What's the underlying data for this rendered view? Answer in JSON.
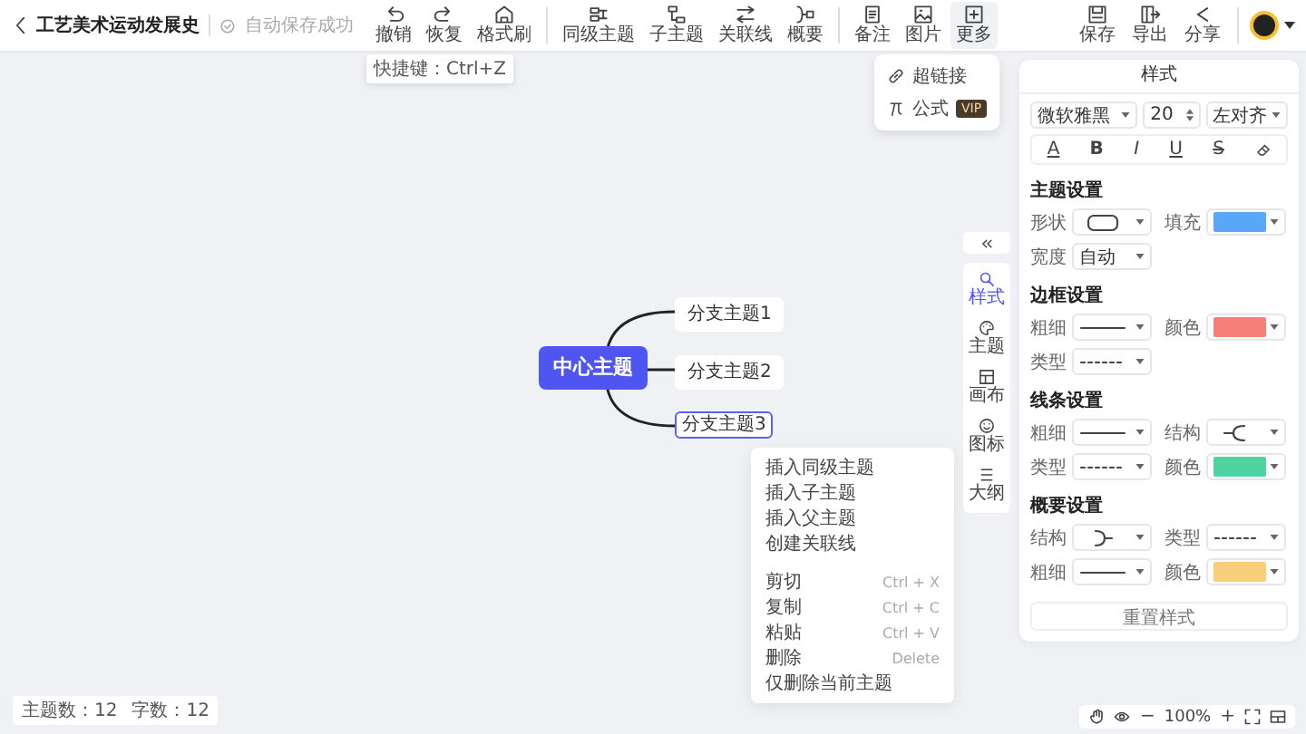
{
  "document": {
    "title": "工艺美术运动发展史",
    "save_status": "自动保存成功"
  },
  "toolbar_groups": [
    {
      "items": [
        {
          "label": "撤销",
          "tooltip": "快捷键：Ctrl+Z"
        },
        {
          "label": "恢复"
        },
        {
          "label": "格式刷"
        }
      ]
    },
    {
      "items": [
        {
          "label": "同级主题"
        },
        {
          "label": "子主题"
        },
        {
          "label": "关联线"
        },
        {
          "label": "概要"
        }
      ]
    },
    {
      "items": [
        {
          "label": "备注"
        },
        {
          "label": "图片"
        },
        {
          "label": "更多",
          "expanded": true
        }
      ]
    }
  ],
  "more_menu": [
    {
      "label": "超链接"
    },
    {
      "label": "公式",
      "badge": "VIP"
    }
  ],
  "right_actions": [
    {
      "label": "保存"
    },
    {
      "label": "导出"
    },
    {
      "label": "分享"
    }
  ],
  "mindmap": {
    "center": "中心主题",
    "branches": [
      {
        "label": "分支主题1",
        "selected": false
      },
      {
        "label": "分支主题2",
        "selected": false
      },
      {
        "label": "分支主题3",
        "selected": true
      }
    ]
  },
  "context_menu": [
    {
      "items": [
        {
          "label": "插入同级主题"
        },
        {
          "label": "插入子主题"
        },
        {
          "label": "插入父主题"
        },
        {
          "label": "创建关联线"
        }
      ]
    },
    {
      "items": [
        {
          "label": "剪切",
          "shortcut": "Ctrl + X"
        },
        {
          "label": "复制",
          "shortcut": "Ctrl + C"
        },
        {
          "label": "粘贴",
          "shortcut": "Ctrl + V"
        },
        {
          "label": "删除",
          "shortcut": "Delete"
        },
        {
          "label": "仅删除当前主题"
        }
      ]
    }
  ],
  "side_tabs": [
    {
      "label": "样式",
      "selected": true
    },
    {
      "label": "主题",
      "selected": false
    },
    {
      "label": "画布",
      "selected": false
    },
    {
      "label": "图标",
      "selected": false
    },
    {
      "label": "大纲",
      "selected": false
    }
  ],
  "style_panel": {
    "title": "样式",
    "font": "微软雅黑",
    "size": "20",
    "align": "左对齐",
    "format": [
      "A",
      "B",
      "I",
      "U",
      "S"
    ],
    "sections": [
      {
        "title": "主题设置",
        "fields": [
          {
            "label": "形状",
            "kind": "shape"
          },
          {
            "label": "填充",
            "kind": "color",
            "color": "#5aa6f8"
          },
          {
            "label": "宽度",
            "kind": "select",
            "value": "自动"
          }
        ]
      },
      {
        "title": "边框设置",
        "fields": [
          {
            "label": "粗细",
            "kind": "line"
          },
          {
            "label": "颜色",
            "kind": "color",
            "color": "#f77f7a"
          },
          {
            "label": "类型",
            "kind": "dash"
          }
        ]
      },
      {
        "title": "线条设置",
        "fields": [
          {
            "label": "粗细",
            "kind": "line"
          },
          {
            "label": "结构",
            "kind": "struct"
          },
          {
            "label": "类型",
            "kind": "dash"
          },
          {
            "label": "颜色",
            "kind": "color",
            "color": "#4fd3a0"
          }
        ]
      },
      {
        "title": "概要设置",
        "fields": [
          {
            "label": "结构",
            "kind": "brace"
          },
          {
            "label": "类型",
            "kind": "dash"
          },
          {
            "label": "粗细",
            "kind": "line"
          },
          {
            "label": "颜色",
            "kind": "color",
            "color": "#f9cf7c"
          }
        ]
      }
    ],
    "reset": "重置样式"
  },
  "status": {
    "topics": "主题数：12",
    "words": "字数：12"
  },
  "zoom": {
    "minus": "−",
    "value": "100%",
    "plus": "+"
  }
}
